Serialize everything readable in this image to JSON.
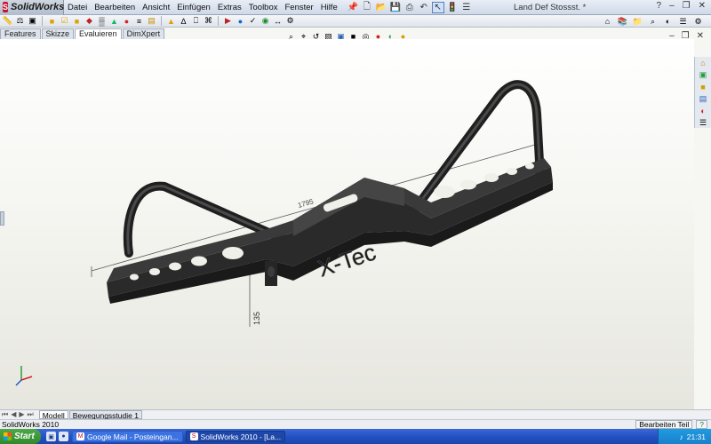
{
  "app": {
    "logo_text": "SolidWorks",
    "window_title": "Land Def Stossst. *",
    "menu": [
      "Datei",
      "Bearbeiten",
      "Ansicht",
      "Einfügen",
      "Extras",
      "Toolbox",
      "Fenster",
      "Hilfe"
    ],
    "help_glyph": "?"
  },
  "command_tabs": [
    {
      "label": "Features",
      "active": false
    },
    {
      "label": "Skizze",
      "active": false
    },
    {
      "label": "Evaluieren",
      "active": true
    },
    {
      "label": "DimXpert",
      "active": false
    }
  ],
  "model": {
    "engraving": "X-Tec",
    "dim_width": "1795",
    "dim_height": "135"
  },
  "bottom_tabs": [
    {
      "label": "Modell",
      "active": true
    },
    {
      "label": "Bewegungsstudie 1",
      "active": false
    }
  ],
  "status": {
    "left_text": "SolidWorks 2010",
    "mode": "Bearbeiten Teil",
    "help": "?"
  },
  "taskbar": {
    "start_label": "Start",
    "buttons": [
      {
        "label": "Google Mail - Posteingan...",
        "active": false
      },
      {
        "label": "SolidWorks 2010 - [La...",
        "active": true
      }
    ],
    "clock": "21:31"
  },
  "colors": {
    "accent": "#c8102e",
    "part": "#2a2a2a"
  }
}
